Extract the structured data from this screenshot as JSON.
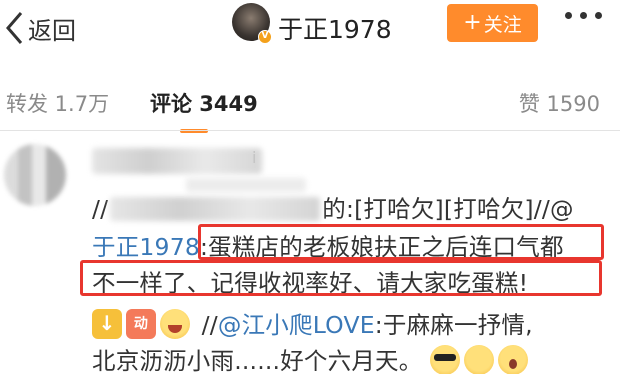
{
  "header": {
    "back_label": "返回",
    "user_name": "于正1978",
    "follow_plus": "+",
    "follow_label": "关注"
  },
  "tabs": {
    "repost": "转发 1.7万",
    "comments": "评论 3449",
    "likes": "赞 1590"
  },
  "comment": {
    "name_tail": "i",
    "line1_prefix": "//",
    "line1_suffix": "的:[打哈欠][打哈欠]//@",
    "line2_mention": "于正1978",
    "line2_colon": ":",
    "line2_text": "蛋糕店的老板娘扶正之后连口气都",
    "line3_text": "不一样了、记得收视率好、请大家吃蛋糕!",
    "line4_prefix": " //",
    "line4_mention": "@江小爬LOVE",
    "line4_text": ":于麻麻一抒情,",
    "line5_text": "北京沥沥小雨......好个六月天。"
  },
  "colors": {
    "accent": "#ff8b2c",
    "link": "#3a78b7",
    "highlight": "#e8362e"
  }
}
